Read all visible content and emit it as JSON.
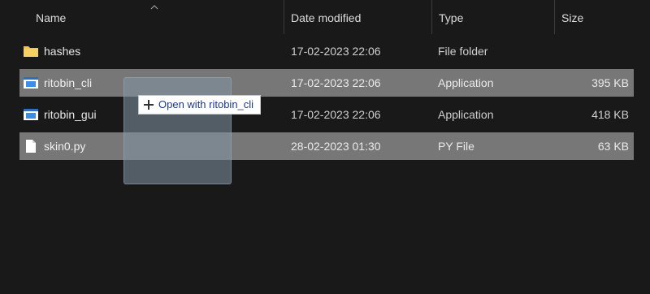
{
  "columns": {
    "name": "Name",
    "date_modified": "Date modified",
    "type": "Type",
    "size": "Size"
  },
  "files": [
    {
      "name": "hashes",
      "date": "17-02-2023 22:06",
      "type": "File folder",
      "size": "",
      "icon": "folder-icon",
      "selected": false
    },
    {
      "name": "ritobin_cli",
      "date": "17-02-2023 22:06",
      "type": "Application",
      "size": "395 KB",
      "icon": "application-icon",
      "selected": true
    },
    {
      "name": "ritobin_gui",
      "date": "17-02-2023 22:06",
      "type": "Application",
      "size": "418 KB",
      "icon": "application-icon",
      "selected": false
    },
    {
      "name": "skin0.py",
      "date": "28-02-2023 01:30",
      "type": "PY File",
      "size": "63 KB",
      "icon": "file-icon",
      "selected": true
    }
  ],
  "drag_tooltip": {
    "text": "Open with ritobin_cli",
    "icon": "plus-icon"
  },
  "colors": {
    "background": "#191919",
    "selection": "#777777",
    "folder": "#f4c34a",
    "tooltip_text": "#1d3a8a"
  }
}
